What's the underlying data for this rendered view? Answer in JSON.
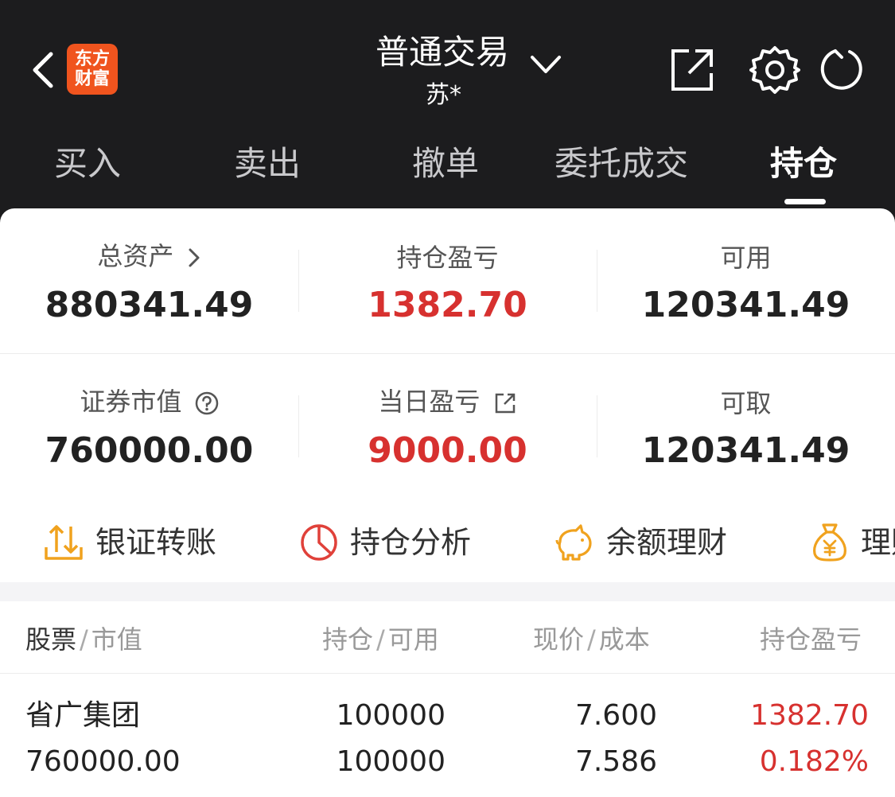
{
  "header": {
    "logo_line1": "东方",
    "logo_line2": "财富",
    "title": "普通交易",
    "subtitle": "苏*",
    "icons": [
      "back-icon",
      "chevron-down-icon",
      "share-icon",
      "gear-icon",
      "refresh-icon"
    ]
  },
  "tabs": [
    {
      "label": "买入",
      "active": false
    },
    {
      "label": "卖出",
      "active": false
    },
    {
      "label": "撤单",
      "active": false
    },
    {
      "label": "委托成交",
      "active": false
    },
    {
      "label": "持仓",
      "active": true
    }
  ],
  "summary": {
    "total_assets": {
      "label": "总资产",
      "value": "880341.49"
    },
    "position_pnl": {
      "label": "持仓盈亏",
      "value": "1382.70"
    },
    "available": {
      "label": "可用",
      "value": "120341.49"
    },
    "securities_value": {
      "label": "证券市值",
      "value": "760000.00"
    },
    "daily_pnl": {
      "label": "当日盈亏",
      "value": "9000.00"
    },
    "withdrawable": {
      "label": "可取",
      "value": "120341.49"
    }
  },
  "shortcuts": [
    {
      "label": "银证转账",
      "icon": "transfer-icon"
    },
    {
      "label": "持仓分析",
      "icon": "pie-chart-icon"
    },
    {
      "label": "余额理财",
      "icon": "piggy-bank-icon"
    },
    {
      "label": "理财",
      "icon": "money-bag-icon"
    }
  ],
  "table": {
    "headers": {
      "col1_main": "股票",
      "col1_sub": "市值",
      "col2_main": "持仓",
      "col2_sub": "可用",
      "col3_main": "现价",
      "col3_sub": "成本",
      "col4_main": "持仓盈亏"
    },
    "rows": [
      {
        "name": "省广集团",
        "market_value": "760000.00",
        "position": "100000",
        "available": "100000",
        "price": "7.600",
        "cost": "7.586",
        "pnl": "1382.70",
        "pnl_pct": "0.182%"
      }
    ]
  },
  "colors": {
    "header_bg": "#1c1c1e",
    "accent_red": "#d7312f",
    "logo_orange": "#f0541e",
    "icon_orange": "#f0a21e"
  }
}
